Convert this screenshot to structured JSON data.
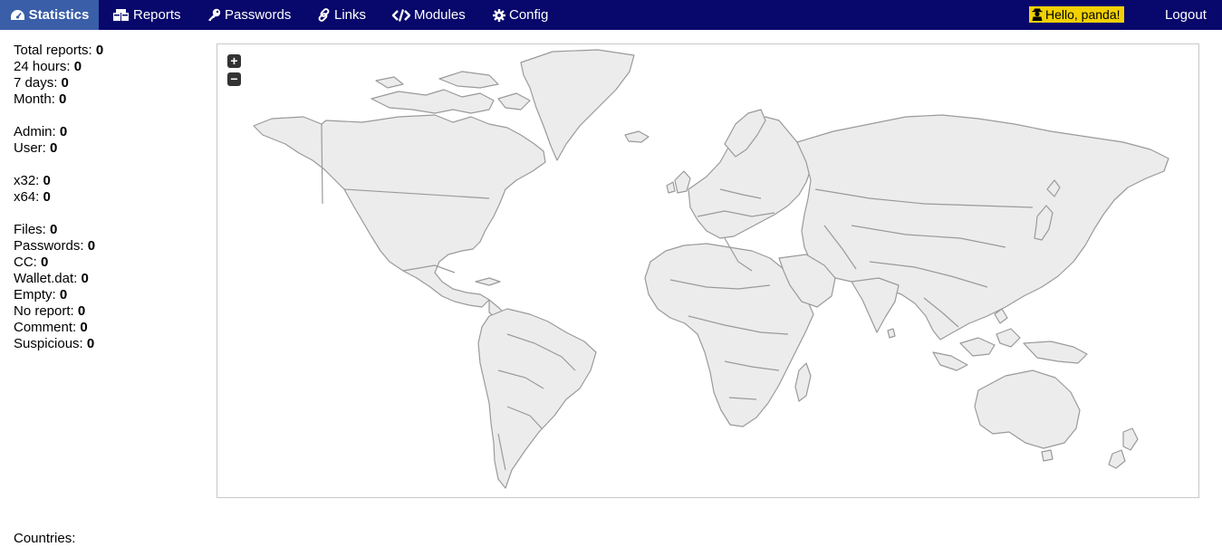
{
  "nav": {
    "items": [
      {
        "label": "Statistics",
        "icon": "dashboard-icon",
        "active": true
      },
      {
        "label": "Reports",
        "icon": "boxes-icon",
        "active": false
      },
      {
        "label": "Passwords",
        "icon": "key-icon",
        "active": false
      },
      {
        "label": "Links",
        "icon": "link-icon",
        "active": false
      },
      {
        "label": "Modules",
        "icon": "code-icon",
        "active": false
      },
      {
        "label": "Config",
        "icon": "gear-icon",
        "active": false
      }
    ],
    "greeting": "Hello, panda!",
    "greeting_icon": "user-secret-icon",
    "logout": "Logout"
  },
  "stats": {
    "total_reports": {
      "label": "Total reports:",
      "value": "0"
    },
    "hours_24": {
      "label": "24 hours:",
      "value": "0"
    },
    "days_7": {
      "label": "7 days:",
      "value": "0"
    },
    "month": {
      "label": "Month:",
      "value": "0"
    },
    "admin": {
      "label": "Admin:",
      "value": "0"
    },
    "user": {
      "label": "User:",
      "value": "0"
    },
    "x32": {
      "label": "x32:",
      "value": "0"
    },
    "x64": {
      "label": "x64:",
      "value": "0"
    },
    "files": {
      "label": "Files:",
      "value": "0"
    },
    "passwords": {
      "label": "Passwords:",
      "value": "0"
    },
    "cc": {
      "label": "CC:",
      "value": "0"
    },
    "wallet": {
      "label": "Wallet.dat:",
      "value": "0"
    },
    "empty": {
      "label": "Empty:",
      "value": "0"
    },
    "no_report": {
      "label": "No report:",
      "value": "0"
    },
    "comment": {
      "label": "Comment:",
      "value": "0"
    },
    "suspicious": {
      "label": "Suspicious:",
      "value": "0"
    }
  },
  "map": {
    "zoom_in": "+",
    "zoom_out": "−",
    "land_color": "#ececec",
    "border_color": "#9a9a9a"
  },
  "countries_label": "Countries:",
  "colors": {
    "topbar": "#08076b",
    "active_tab": "#3a5ea8",
    "greeting_bg": "#f2d100"
  }
}
